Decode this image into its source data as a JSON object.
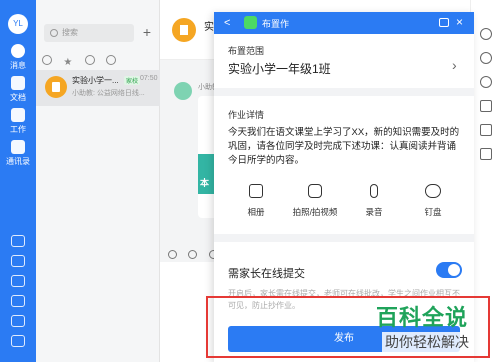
{
  "rail": {
    "avatar_text": "YL",
    "nav": [
      {
        "label": "消息"
      },
      {
        "label": "文档"
      },
      {
        "label": "工作"
      },
      {
        "label": "通讯录"
      }
    ]
  },
  "sessions": {
    "search_placeholder": "搜索",
    "plus": "+",
    "item": {
      "name": "实验小学一...",
      "tag": "家校",
      "time": "07:50",
      "preview": "小助教: 公益网络日线..."
    }
  },
  "chat": {
    "title": "实",
    "sender": "小助教"
  },
  "panel": {
    "title": "布置作",
    "back": "<",
    "close": "×",
    "scope_label": "布置范围",
    "scope_value": "实验小学一年级1班",
    "detail_label": "作业详情",
    "detail_text": "今天我们在语文课堂上学习了XX，新的知识需要及时的巩固，请各位同学及时完成下述功课：认真阅读并背诵今日所学的内容。",
    "tools": [
      {
        "label": "相册",
        "icon": "image-icon"
      },
      {
        "label": "拍照/拍视频",
        "icon": "camera-icon"
      },
      {
        "label": "录音",
        "icon": "microphone-icon"
      },
      {
        "label": "钉盘",
        "icon": "cloud-icon"
      }
    ],
    "parent_submit_label": "需家长在线提交",
    "parent_submit_on": true,
    "hint": "开启后，家长需在线提交，老师可在线批改，学生之间作业相互不可见，防止抄作业。",
    "publish_label": "发布"
  },
  "watermark": {
    "main": "百科全说",
    "sub": "助你轻松解决"
  },
  "colors": {
    "accent": "#2b7bf3",
    "highlight_box": "#e53935",
    "watermark_green": "#1fa35a"
  }
}
